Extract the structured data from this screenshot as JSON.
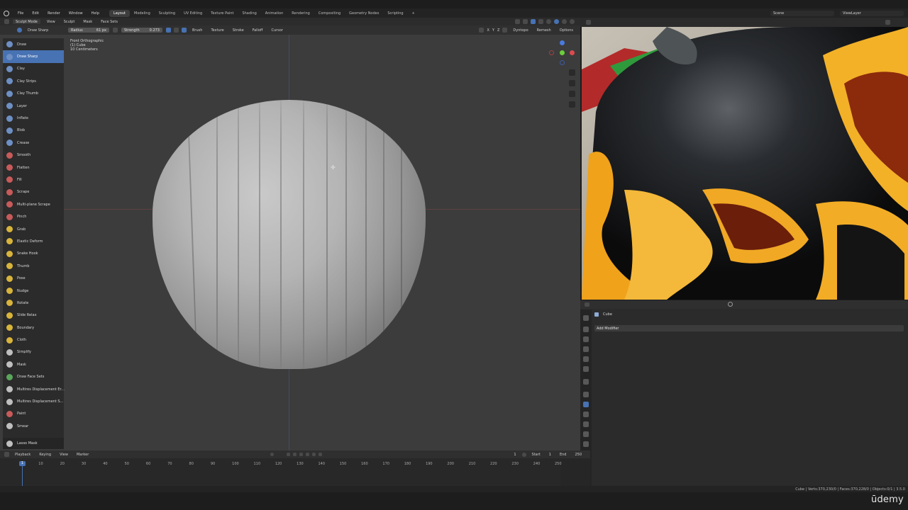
{
  "topbar": {
    "menus": [
      "File",
      "Edit",
      "Render",
      "Window",
      "Help"
    ],
    "workspaces": [
      "Layout",
      "Modeling",
      "Sculpting",
      "UV Editing",
      "Texture Paint",
      "Shading",
      "Animation",
      "Rendering",
      "Compositing",
      "Geometry Nodes",
      "Scripting"
    ],
    "active_workspace": "Layout",
    "scene": "Scene",
    "view_layer": "ViewLayer"
  },
  "viewport_header": {
    "mode": "Sculpt Mode",
    "menus": [
      "View",
      "Sculpt",
      "Mask",
      "Face Sets"
    ]
  },
  "tool_header": {
    "brush_name": "Draw Sharp",
    "radius_label": "Radius",
    "radius_value": "61 px",
    "strength_label": "Strength",
    "strength_value": "0.273",
    "menus": [
      "Brush",
      "Texture",
      "Stroke",
      "Falloff",
      "Cursor"
    ],
    "axes": [
      "X",
      "Y",
      "Z"
    ],
    "right_menus": [
      "Dyntopo",
      "Remesh",
      "Options"
    ]
  },
  "viewport_info": {
    "line1": "Front Orthographic",
    "line2": "(1) Cube",
    "line3": "10 Centimeters"
  },
  "brushes": [
    {
      "name": "Draw",
      "color": "#6d8fc4"
    },
    {
      "name": "Draw Sharp",
      "color": "#6d8fc4",
      "active": true
    },
    {
      "name": "Clay",
      "color": "#6d8fc4"
    },
    {
      "name": "Clay Strips",
      "color": "#6d8fc4"
    },
    {
      "name": "Clay Thumb",
      "color": "#6d8fc4"
    },
    {
      "name": "Layer",
      "color": "#6d8fc4"
    },
    {
      "name": "Inflate",
      "color": "#6d8fc4"
    },
    {
      "name": "Blob",
      "color": "#6d8fc4"
    },
    {
      "name": "Crease",
      "color": "#6d8fc4"
    },
    {
      "name": "Smooth",
      "color": "#c85a5a"
    },
    {
      "name": "Flatten",
      "color": "#c85a5a"
    },
    {
      "name": "Fill",
      "color": "#c85a5a"
    },
    {
      "name": "Scrape",
      "color": "#c85a5a"
    },
    {
      "name": "Multi-plane Scrape",
      "color": "#c85a5a"
    },
    {
      "name": "Pinch",
      "color": "#c85a5a"
    },
    {
      "name": "Grab",
      "color": "#d8b43a"
    },
    {
      "name": "Elastic Deform",
      "color": "#d8b43a"
    },
    {
      "name": "Snake Hook",
      "color": "#d8b43a"
    },
    {
      "name": "Thumb",
      "color": "#d8b43a"
    },
    {
      "name": "Pose",
      "color": "#d8b43a"
    },
    {
      "name": "Nudge",
      "color": "#d8b43a"
    },
    {
      "name": "Rotate",
      "color": "#d8b43a"
    },
    {
      "name": "Slide Relax",
      "color": "#d8b43a"
    },
    {
      "name": "Boundary",
      "color": "#d8b43a"
    },
    {
      "name": "Cloth",
      "color": "#d8b43a"
    },
    {
      "name": "Simplify",
      "color": "#bfbfbf"
    },
    {
      "name": "Mask",
      "color": "#bfbfbf"
    },
    {
      "name": "Draw Face Sets",
      "color": "#5aa65a"
    },
    {
      "name": "Multires Displacement Er...",
      "color": "#bfbfbf"
    },
    {
      "name": "Multires Displacement S...",
      "color": "#bfbfbf"
    },
    {
      "name": "Paint",
      "color": "#c85a5a"
    },
    {
      "name": "Smear",
      "color": "#bfbfbf"
    }
  ],
  "lasso_tool": "Lasso Mask",
  "properties": {
    "object_name": "Cube",
    "add_modifier": "Add Modifier"
  },
  "timeline": {
    "menus": [
      "Playback",
      "Keying",
      "View",
      "Marker"
    ],
    "current_frame": "1",
    "start_label": "Start",
    "start_value": "1",
    "end_label": "End",
    "end_value": "250",
    "ticks": [
      "1",
      "10",
      "20",
      "30",
      "40",
      "50",
      "60",
      "70",
      "80",
      "90",
      "100",
      "110",
      "120",
      "130",
      "140",
      "150",
      "160",
      "170",
      "180",
      "190",
      "200",
      "210",
      "220",
      "230",
      "240",
      "250"
    ]
  },
  "statusbar": {
    "stats": "Cube | Verts:370,230/0 | Faces:370,228/0 | Objects:0/1 | 3.5.0"
  },
  "watermark": "ūdemy",
  "colors": {
    "accent": "#4772b3",
    "viewport_bg": "#3c3c3c",
    "panel_bg": "#2b2b2b"
  }
}
